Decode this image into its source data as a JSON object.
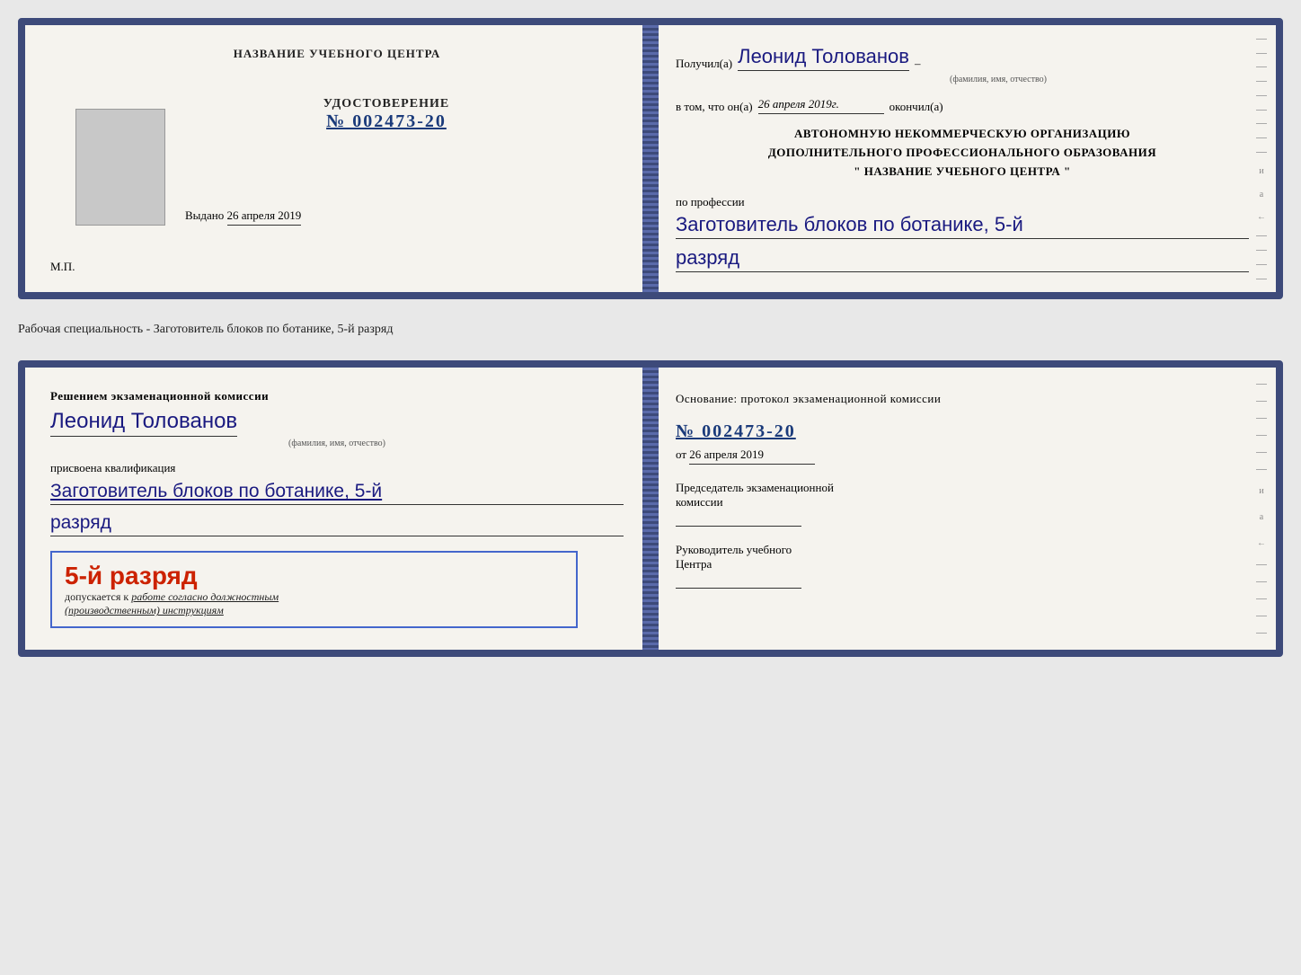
{
  "top_doc": {
    "left": {
      "training_center_label": "НАЗВАНИЕ УЧЕБНОГО ЦЕНТРА",
      "udostoverenie_title": "УДОСТОВЕРЕНИЕ",
      "udostoverenie_number": "№ 002473-20",
      "vydano_label": "Выдано",
      "vydano_date": "26 апреля 2019",
      "mp_label": "М.П."
    },
    "right": {
      "poluchil_label": "Получил(а)",
      "poluchil_name": "Леонид Толованов",
      "fio_hint": "(фамилия, имя, отчество)",
      "vtom_label": "в том, что он(а)",
      "vtom_date": "26 апреля 2019г.",
      "okonchil_label": "окончил(а)",
      "autonomy_line1": "АВТОНОМНУЮ НЕКОММЕРЧЕСКУЮ ОРГАНИЗАЦИЮ",
      "autonomy_line2": "ДОПОЛНИТЕЛЬНОГО ПРОФЕССИОНАЛЬНОГО ОБРАЗОВАНИЯ",
      "autonomy_line3": "\"   НАЗВАНИЕ УЧЕБНОГО ЦЕНТРА   \"",
      "po_professii_label": "по профессии",
      "profession_value": "Заготовитель блоков по ботанике, 5-й",
      "razryad_value": "разряд"
    }
  },
  "specialty_text": "Рабочая специальность - Заготовитель блоков по ботанике, 5-й разряд",
  "bottom_doc": {
    "left": {
      "resheniem_label": "Решением экзаменационной комиссии",
      "person_name": "Леонид Толованов",
      "fio_hint": "(фамилия, имя, отчество)",
      "prisvoena_label": "присвоена квалификация",
      "qualification_value": "Заготовитель блоков по ботанике, 5-й",
      "razryad_value": "разряд",
      "dopusk_razryad": "5-й разряд",
      "dopusk_prefix": "допускается к",
      "dopusk_text": "работе согласно должностным",
      "dopusk_italic": "(производственным) инструкциям"
    },
    "right": {
      "osnovanie_label": "Основание: протокол экзаменационной комиссии",
      "protocol_number": "№  002473-20",
      "ot_label": "от",
      "ot_date": "26 апреля 2019",
      "predsedatel_label": "Председатель экзаменационной",
      "komissii_label": "комиссии",
      "rukovoditel_label": "Руководитель учебного",
      "tsentra_label": "Центра"
    }
  }
}
